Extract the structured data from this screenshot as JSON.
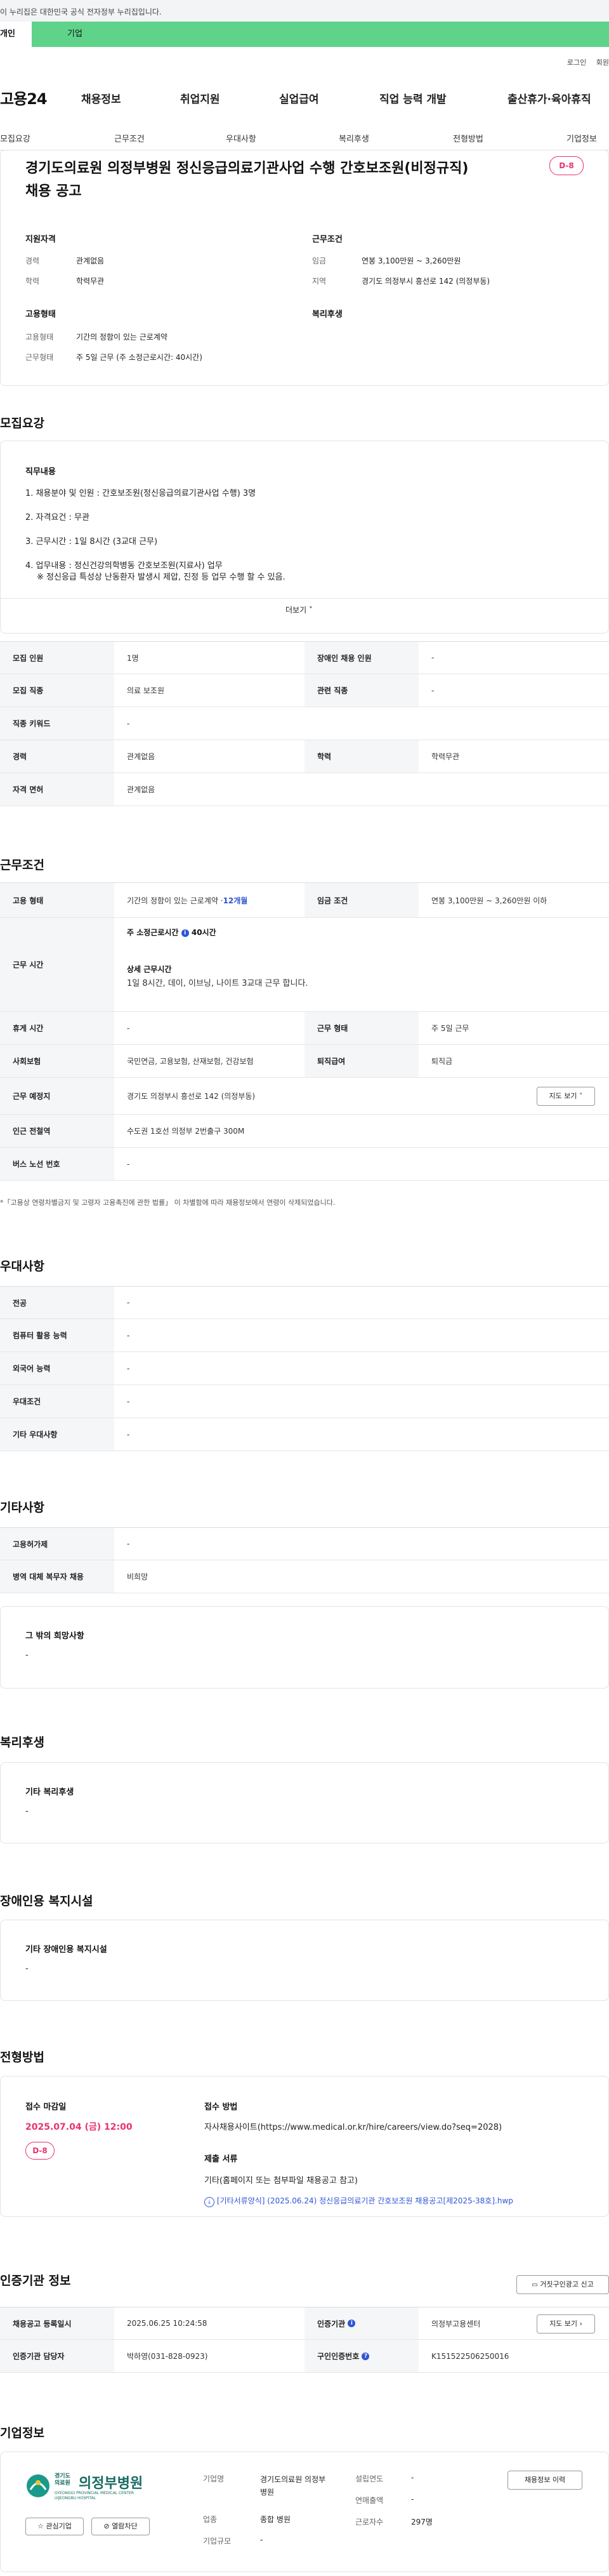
{
  "gov": {
    "text": "이 누리집은 대한민국 공식 전자정부 누리집입니다."
  },
  "user_tabs": {
    "person": "개인",
    "corp": "기업"
  },
  "top_links": [
    "로그인",
    "회원"
  ],
  "logo": "고용24",
  "gnb": [
    "채용정보",
    "취업지원",
    "실업급여",
    "직업 능력 개발",
    "출산휴가·육아휴직"
  ],
  "anchors": [
    "모집요강",
    "근무조건",
    "우대사항",
    "복리후생",
    "전형방법",
    "기업정보"
  ],
  "summary": {
    "title": "경기도의료원 의정부병원 정신응급의료기관사업 수행 간호보조원(비정규직) 채용 공고",
    "dday": "D-8",
    "support_qual_heading": "지원자격",
    "career_label": "경력",
    "career_value": "관계없음",
    "edu_label": "학력",
    "edu_value": "학력무관",
    "work_cond_heading": "근무조건",
    "wage_label": "임금",
    "wage_value": "연봉 3,100만원 ~ 3,260만원",
    "region_label": "지역",
    "region_value": "경기도 의정부시 흥선로 142 (의정부동)",
    "emp_heading": "고용형태",
    "welfare_heading": "복리후생",
    "emp_type_label": "고용형태",
    "emp_type_value": "기간의 정함이 있는 근로계약",
    "work_form_label": "근무형태",
    "work_form_value": "주 5일 근무 (주 소정근로시간: 40시간)"
  },
  "recruit": {
    "heading": "모집요강",
    "duty_heading": "직무내용",
    "lines": [
      "1. 채용분야 및 인원 : 간호보조원(정신응급의료기관사업 수행) 3명",
      "2. 자격요건 : 무관",
      "3. 근무시간 : 1일 8시간 (3교대 근무)",
      "4. 업무내용 : 정신건강의학병동 간호보조원(지료사) 업무",
      "※ 정신응급 특성상 난동환자 발생시 제압, 진정 등 업무 수행 할 수 있음."
    ],
    "more": "더보기 ˅",
    "table": [
      [
        "모집 인원",
        "1명",
        "장애인 채용 인원",
        "-"
      ],
      [
        "모집 직종",
        "의료 보조원",
        "관련 직종",
        "-"
      ],
      [
        "직종 키워드",
        "-"
      ],
      [
        "경력",
        "관계없음",
        "학력",
        "학력무관"
      ],
      [
        "자격 면허",
        "관계없음"
      ]
    ]
  },
  "conditions": {
    "heading": "근무조건",
    "emp_type_label": "고용 형태",
    "emp_type_value": "기간의 정함이 있는 근로계약 · ",
    "emp_period": "12개월",
    "wage_label": "임금 조건",
    "wage_value": "연봉 3,100만원 ~ 3,260만원 이하",
    "hours_label": "근무 시간",
    "weekly_label": "주 소정근로시간",
    "weekly_value": "40시간",
    "detail_label": "상세 근무시간",
    "detail_value": "1일 8시간, 데이, 이브닝, 나이트 3교대 근무 합니다.",
    "rest_label": "휴게 시간",
    "rest_value": "-",
    "form_label": "근무 형태",
    "form_value": "주 5일 근무",
    "insurance_label": "사회보험",
    "insurance_value": "국민연금, 고용보험, 산재보험, 건강보험",
    "severance_label": "퇴직급여",
    "severance_value": "퇴직금",
    "place_label": "근무 예정지",
    "place_value": "경기도 의정부시 흥선로 142 (의정부동)",
    "map_btn": "지도 보기 ˅",
    "subway_label": "인근 전철역",
    "subway_value": "수도권 1호선 의정부 2번출구 300M",
    "bus_label": "버스 노선 번호",
    "bus_value": "-",
    "note": "*「고용상 연령차별금지 및 고령자 고용촉진에 관한 법률」 이 차별함에 따라 채용정보에서 연령이 삭제되었습니다."
  },
  "preference": {
    "heading": "우대사항",
    "rows": [
      [
        "전공",
        "-"
      ],
      [
        "컴퓨터 활용 능력",
        "-"
      ],
      [
        "외국어 능력",
        "-"
      ],
      [
        "우대조건",
        "-"
      ],
      [
        "기타 우대사항",
        "-"
      ]
    ]
  },
  "other": {
    "heading": "기타사항",
    "rows": [
      [
        "고용허가제",
        "-"
      ],
      [
        "병역 대체 복무자 채용",
        "비희망"
      ]
    ],
    "box_title": "그 밖의 희망사항",
    "box_value": "-"
  },
  "welfare": {
    "heading": "복리후생",
    "box_title": "기타 복리후생",
    "box_value": "-"
  },
  "disabled": {
    "heading": "장애인용 복지시설",
    "box_title": "기타 장애인용 복지시설",
    "box_value": "-"
  },
  "selection": {
    "heading": "전형방법",
    "deadline_label": "접수 마감일",
    "deadline_value": "2025.07.04 (금) 12:00",
    "dday": "D-8",
    "method_label": "접수 방법",
    "method_value": "자사채용사이트(https://www.medical.or.kr/hire/careers/view.do?seq=2028)",
    "docs_label": "제출 서류",
    "docs_value": "기타(홈페이지 또는 첨부파일 채용공고 참고)",
    "file": "[기타서류양식] (2025.06.24) 정신응급의료기관 간호보조원 채용공고[제2025-38호].hwp"
  },
  "cert": {
    "heading": "인증기관 정보",
    "report_btn": "거짓구인광고 신고",
    "row1": [
      "채용공고 등록일시",
      "2025.06.25 10:24:58",
      "인증기관",
      "의정부고용센터"
    ],
    "view_btn": "지도 보기 ›",
    "row2": [
      "인증기관 담당자",
      "박하영(031-828-0923)",
      "구인인증번호",
      "K151522506250016"
    ]
  },
  "company": {
    "heading": "기업정보",
    "logo_top": "경기도 의료원",
    "logo_name": "의정부병원",
    "logo_en": "GYEONGGI PROVINCIAL MEDICAL CENTER UIJEONGBU HOSPITAL",
    "interest_btn": "☆ 관심기업",
    "block_btn": "⊘ 열람차단",
    "name_label": "기업명",
    "name_value": "경기도의료원 의정부병원",
    "industry_label": "업종",
    "industry_value": "종합 병원",
    "scale_label": "기업규모",
    "scale_value": "-",
    "founded_label": "설립연도",
    "founded_value": "-",
    "sales_label": "연매출액",
    "sales_value": "-",
    "workers_label": "근로자수",
    "workers_value": "297명",
    "jobs_btn": "채용정보 이력"
  }
}
